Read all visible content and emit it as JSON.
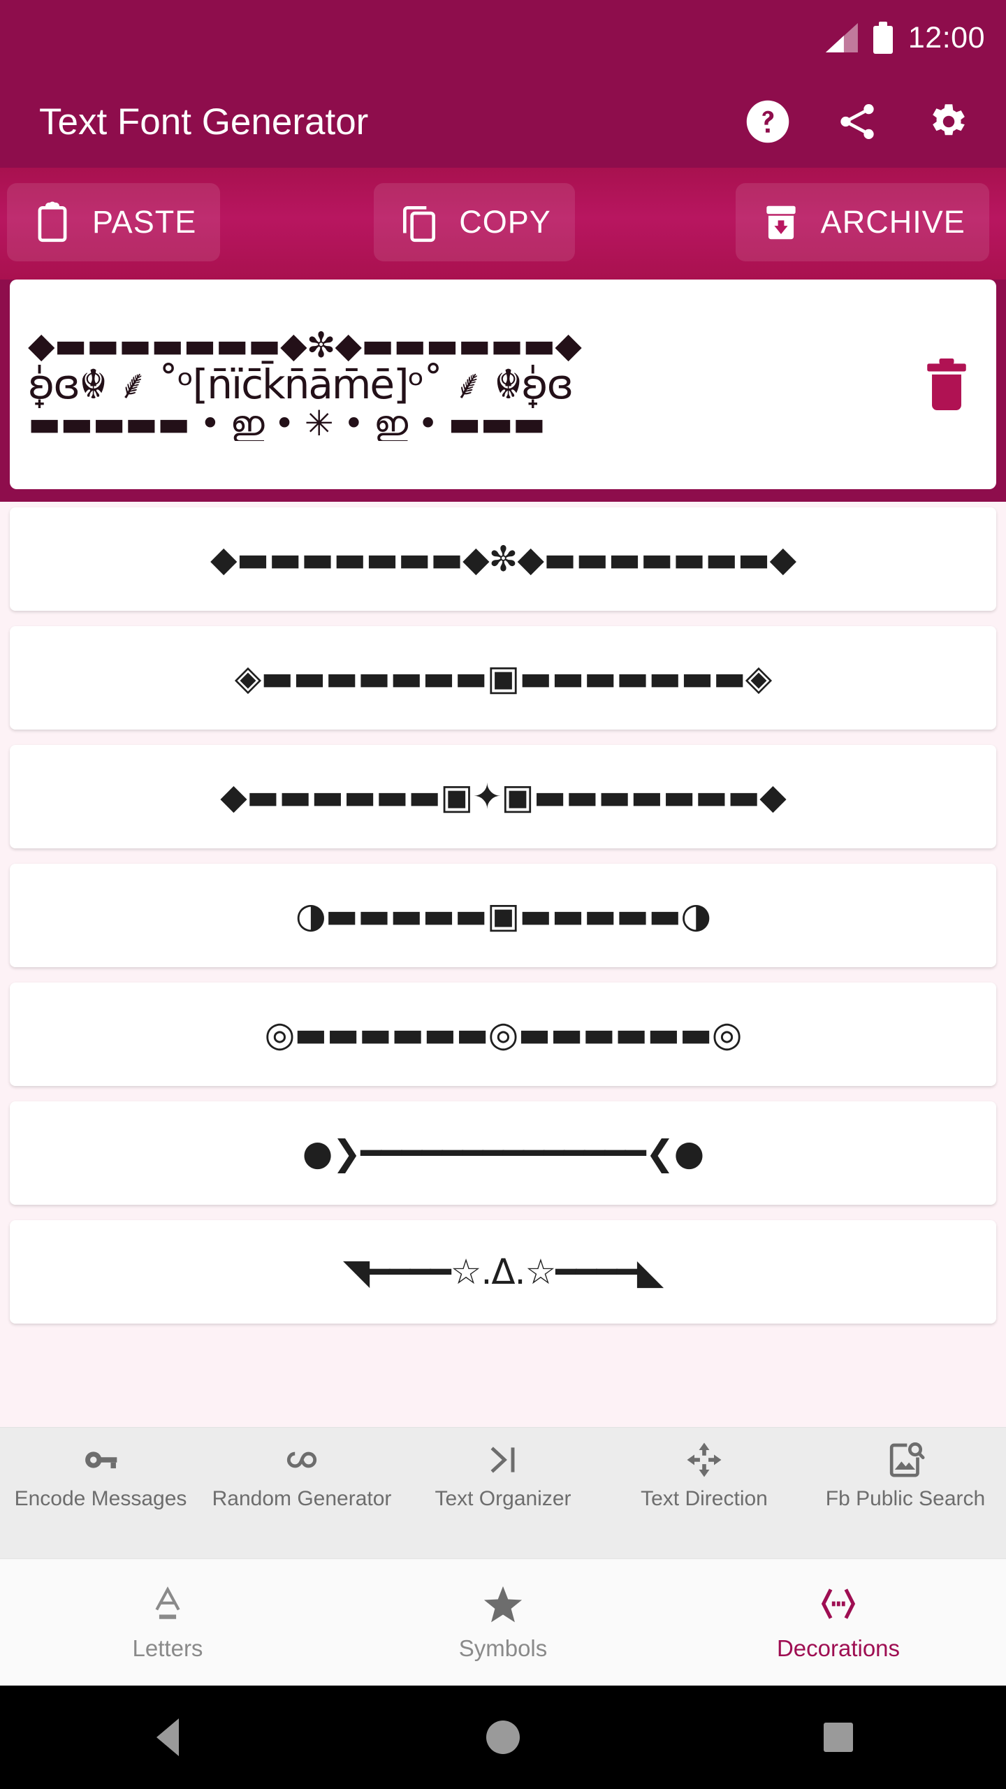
{
  "status_bar": {
    "time": "12:00",
    "signal_icon": "signal-icon",
    "battery_icon": "battery-icon"
  },
  "app_bar": {
    "title": "Text Font Generator",
    "actions": [
      {
        "name": "help-icon",
        "label": "Help"
      },
      {
        "name": "share-icon",
        "label": "Share"
      },
      {
        "name": "settings-gear-icon",
        "label": "Settings"
      }
    ]
  },
  "toolbar": {
    "paste_label": "PASTE",
    "copy_label": "COPY",
    "archive_label": "ARCHIVE"
  },
  "input_card": {
    "decorated_text_line1": "◆▬▬▬▬▬▬▬◆✼◆▬▬▬▬▬▬◆",
    "decorated_text_line2": "ʚ̟̍ɞ☬ ⸙ ˚ᵒ[n̄ïc̄k̄n̄ām̄ē]ᵒ˚ ⸙ ☬ʚ̟̍ɞ",
    "decorated_text_line3": "▬▬▬▬▬ • ഇ • ✳ • ഇ • ▬▬▬",
    "delete_icon": "trash-icon"
  },
  "decorations": [
    {
      "text": "◆▬▬▬▬▬▬▬◆✼◆▬▬▬▬▬▬▬◆"
    },
    {
      "text": "◈▬▬▬▬▬▬▬▣▬▬▬▬▬▬▬◈"
    },
    {
      "text": "◆▬▬▬▬▬▬▣✦▣▬▬▬▬▬▬▬◆"
    },
    {
      "text": "◑▬▬▬▬▬▣▬▬▬▬▬◑"
    },
    {
      "text": "◎▬▬▬▬▬▬◎▬▬▬▬▬▬◎"
    },
    {
      "text": "●❯━━━━━━━━━━━━━━❮●"
    },
    {
      "text": "◥━━━━☆.Δ.☆━━━━◣"
    }
  ],
  "tool_strip": [
    {
      "icon": "key-icon",
      "label": "Encode Messages"
    },
    {
      "icon": "infinity-icon",
      "label": "Random Generator"
    },
    {
      "icon": "text-organizer-icon",
      "label": "Text Organizer"
    },
    {
      "icon": "move-arrows-icon",
      "label": "Text Direction"
    },
    {
      "icon": "image-search-icon",
      "label": "Fb Public Search"
    }
  ],
  "bottom_nav": {
    "items": [
      {
        "icon": "letter-a-icon",
        "label": "Letters",
        "active": false
      },
      {
        "icon": "star-icon",
        "label": "Symbols",
        "active": false
      },
      {
        "icon": "decorations-icon",
        "label": "Decorations",
        "active": true
      }
    ]
  },
  "android_nav": {
    "back": "back-triangle-icon",
    "home": "home-circle-icon",
    "recents": "recents-square-icon"
  },
  "colors": {
    "primary_dark": "#8E0D4C",
    "primary": "#A8114F",
    "accent": "#9E0E52",
    "list_background": "#FDF2F6",
    "tool_strip_bg": "#ECECEC"
  }
}
